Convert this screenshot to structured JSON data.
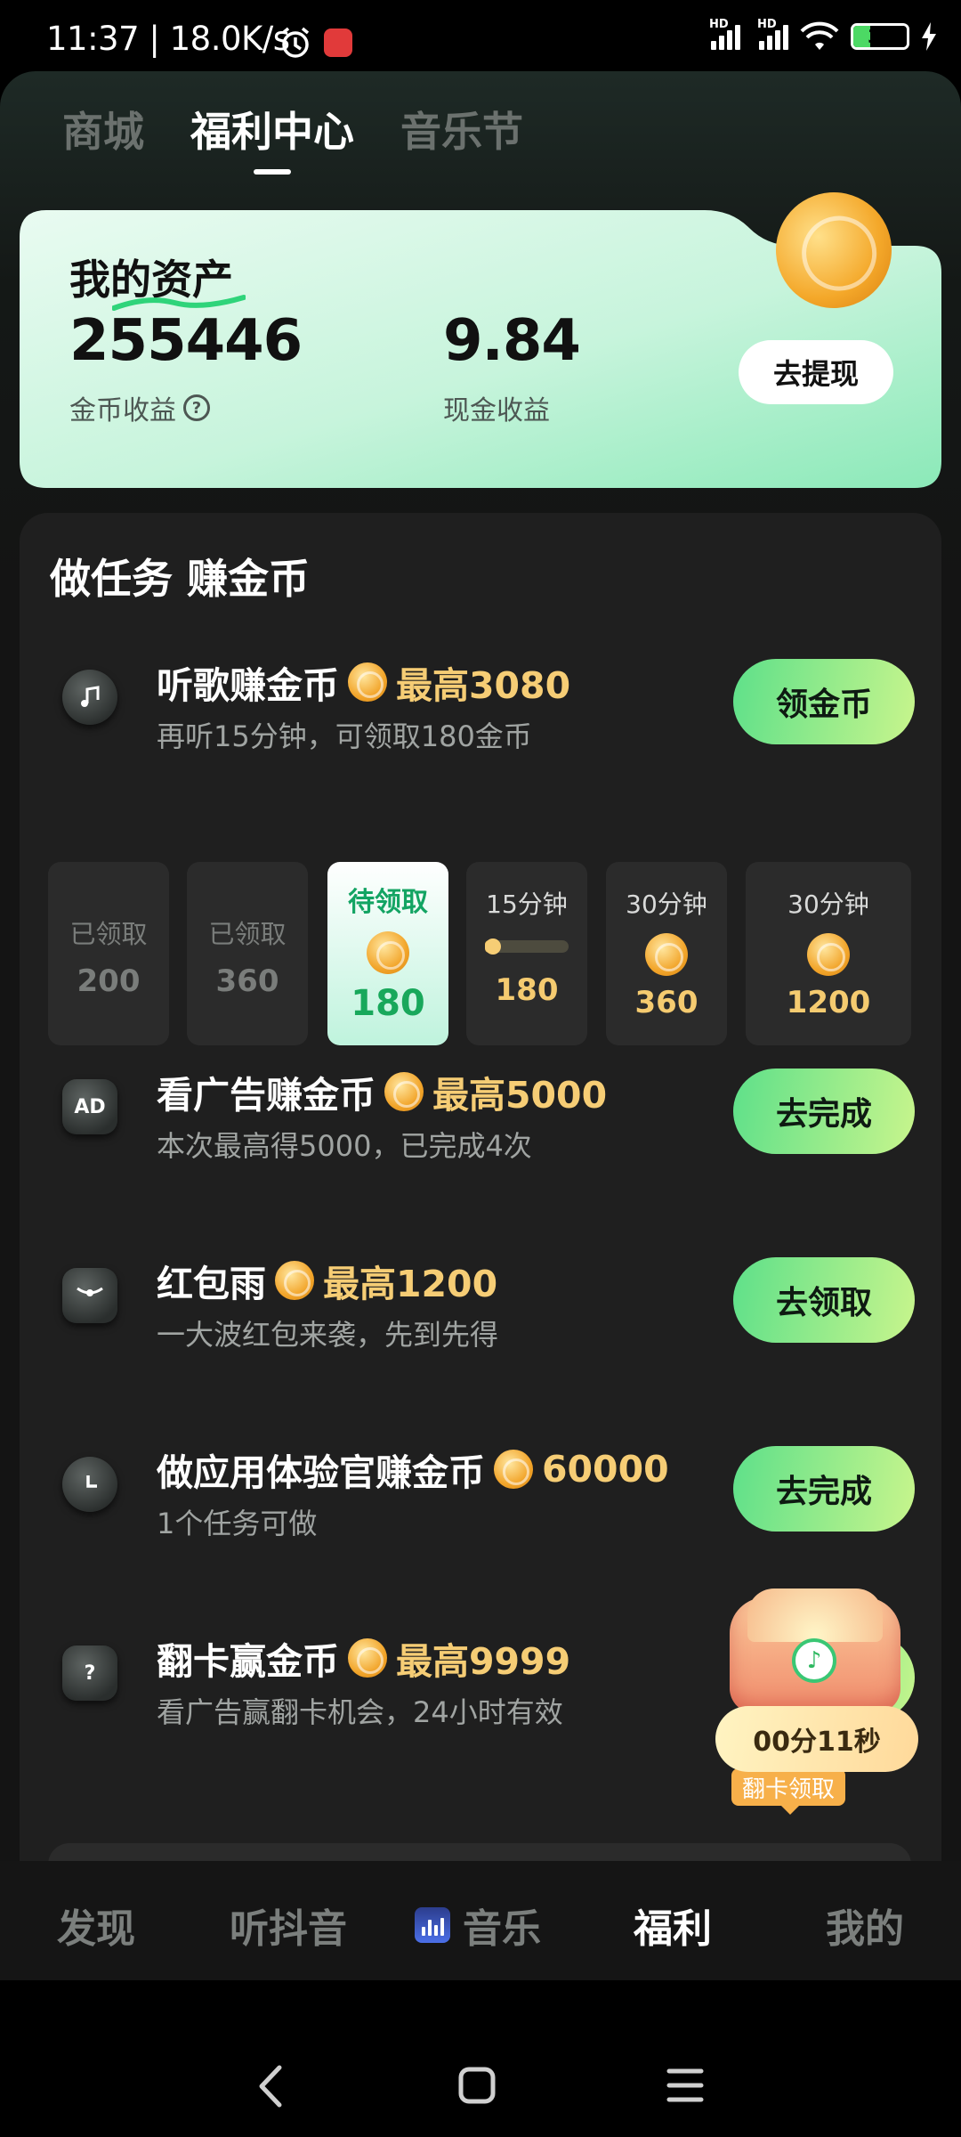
{
  "status_bar": {
    "time": "11:37",
    "speed": "18.0K/s",
    "battery": "31",
    "battery_level": 0.31,
    "hd1": "HD",
    "hd2": "HD",
    "app_icon": "app-notification-icon",
    "alarm_icon": "alarm-clock-icon"
  },
  "top_tabs": [
    {
      "label": "商城",
      "active": false
    },
    {
      "label": "福利中心",
      "active": true
    },
    {
      "label": "音乐节",
      "active": false
    }
  ],
  "assets": {
    "title": "我的资产",
    "coins": "255446",
    "coins_label": "金币收益",
    "cash": "9.84",
    "cash_label": "现金收益",
    "withdraw_button": "去提现",
    "help_icon": "question-circle-icon"
  },
  "tasks_section": {
    "title": "做任务 赚金币",
    "listen": {
      "title": "听歌赚金币",
      "reward": "最高3080",
      "subtitle": "再听15分钟，可领取180金币",
      "button": "领金币",
      "icon": "music-note-icon"
    },
    "tiles": [
      {
        "label": "已领取",
        "value": "200",
        "state": "claimed"
      },
      {
        "label": "已领取",
        "value": "360",
        "state": "claimed"
      },
      {
        "label": "待领取",
        "value": "180",
        "state": "pending"
      },
      {
        "label": "15分钟",
        "value": "180",
        "state": "progress",
        "progress": 0.1
      },
      {
        "label": "30分钟",
        "value": "360",
        "state": "locked"
      },
      {
        "label": "30分钟",
        "value": "1200",
        "state": "locked"
      }
    ],
    "items": [
      {
        "title": "看广告赚金币",
        "reward": "最高5000",
        "subtitle": "本次最高得5000，已完成4次",
        "button": "去完成",
        "icon": "ad-icon",
        "icon_text": "AD"
      },
      {
        "title": "红包雨",
        "reward": "最高1200",
        "subtitle": "一大波红包来袭，先到先得",
        "button": "去领取",
        "icon": "red-packet-icon"
      },
      {
        "title": "做应用体验官赚金币",
        "reward": "60000",
        "subtitle": "1个任务可做",
        "button": "去完成",
        "icon": "clock-icon"
      },
      {
        "title": "翻卡赢金币",
        "reward": "最高9999",
        "subtitle": "看广告赢翻卡机会，24小时有效",
        "button": "",
        "icon": "card-question-icon",
        "icon_text": "?"
      }
    ],
    "flip_tag": "翻卡领取",
    "timer": "00分11秒"
  },
  "bottom_nav": [
    {
      "label": "发现",
      "active": false
    },
    {
      "label": "听抖音",
      "active": false
    },
    {
      "label": "音乐",
      "active": false,
      "icon": "music-app-icon"
    },
    {
      "label": "福利",
      "active": true
    },
    {
      "label": "我的",
      "active": false
    }
  ],
  "system_nav": {
    "back": "back-icon",
    "home": "home-icon",
    "menu": "menu-icon"
  },
  "colors": {
    "accent_green": "#5ee08a",
    "gold": "#f6cd75",
    "background": "#141414"
  }
}
